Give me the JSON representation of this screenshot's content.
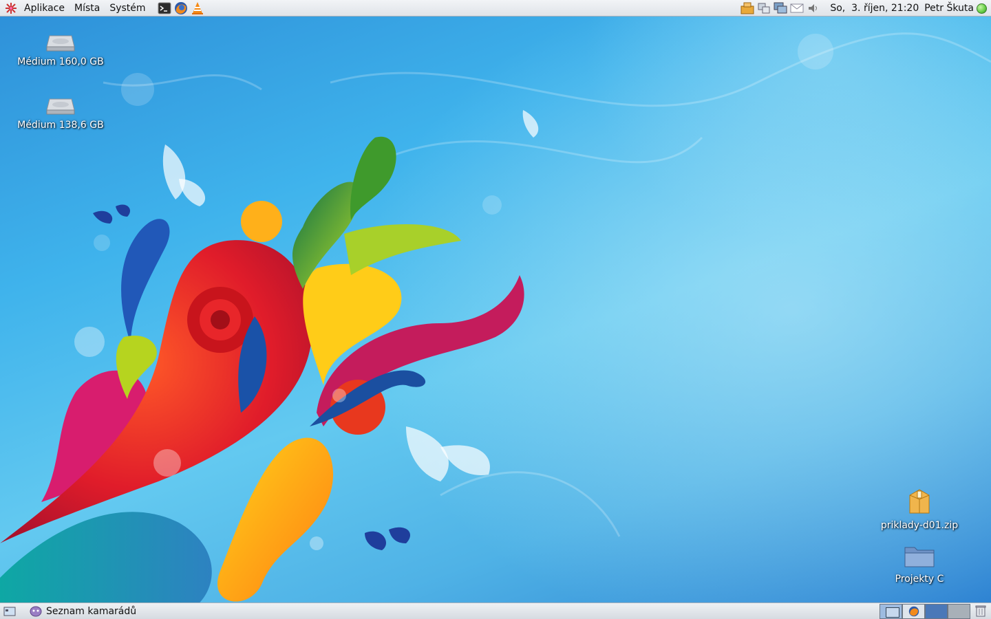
{
  "top_panel": {
    "menus": [
      {
        "label": "Aplikace"
      },
      {
        "label": "Místa"
      },
      {
        "label": "Systém"
      }
    ],
    "launchers": [
      "terminal-icon",
      "firefox-icon",
      "vlc-icon"
    ],
    "tray": [
      "package-updates-icon",
      "network-icon",
      "display-icon",
      "mail-icon",
      "volume-icon"
    ],
    "clock": "So,  3. říjen, 21:20",
    "user": "Petr Škuta",
    "status_color": "#6bd14a"
  },
  "desktop": {
    "icons": [
      {
        "label": "Médium 160,0 GB",
        "icon": "hard-drive-icon"
      },
      {
        "label": "Médium 138,6 GB",
        "icon": "hard-drive-icon"
      },
      {
        "label": "priklady-d01.zip",
        "icon": "zip-archive-icon"
      },
      {
        "label": "Projekty C",
        "icon": "folder-icon"
      }
    ]
  },
  "bottom_panel": {
    "task": {
      "label": "Seznam kamarádů",
      "icon": "pidgin-icon"
    },
    "workspaces": 4,
    "trash_icon": "trash-icon"
  },
  "colors": {
    "panel": "#e6e9ed",
    "desktop_blue": "#3fb3ec"
  }
}
